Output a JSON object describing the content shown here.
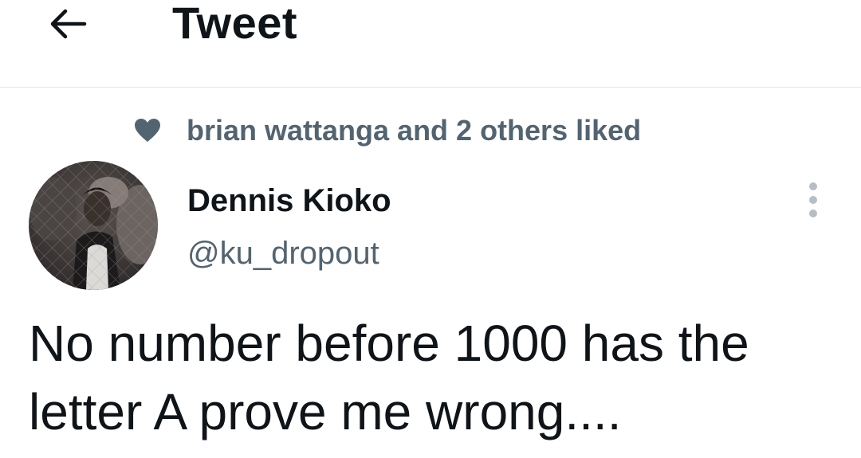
{
  "header": {
    "title": "Tweet",
    "back_icon": "arrow-left-icon"
  },
  "social_context": {
    "icon": "heart-icon",
    "text": "brian wattanga and 2 others liked"
  },
  "tweet": {
    "author_name": "Dennis Kioko",
    "author_handle": "@ku_dropout",
    "more_icon": "more-vertical-icon",
    "text": "No number before 1000 has the letter A prove me wrong...."
  },
  "colors": {
    "text_primary": "#0f1419",
    "text_secondary": "#536471",
    "divider": "#e6e6e6",
    "more_dots": "#b5bec5"
  }
}
